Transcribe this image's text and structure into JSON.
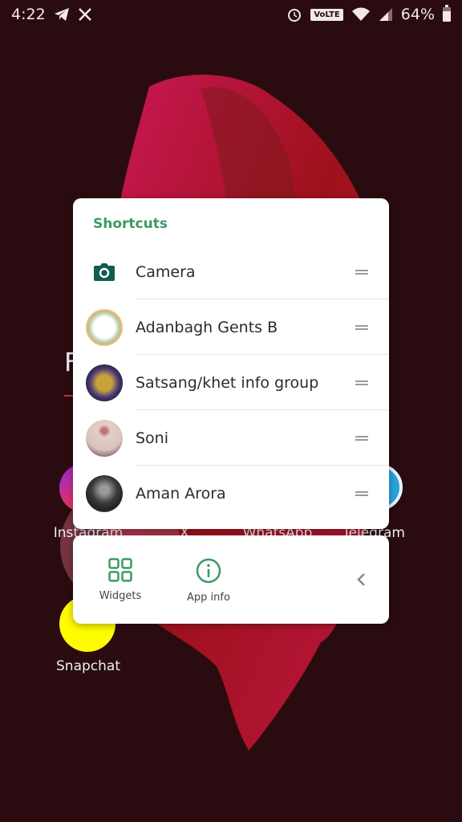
{
  "status_bar": {
    "time": "4:22",
    "notification_icons": [
      "telegram-icon",
      "x-icon"
    ],
    "system_icons": [
      "alarm-icon",
      "volte-icon",
      "wifi-icon",
      "signal-icon"
    ],
    "volte_label": "VoLTE",
    "battery_percent": "64%",
    "battery_level": 0.64
  },
  "home": {
    "folder_letter": "F",
    "apps": [
      {
        "name": "Instagram",
        "icon": "instagram-icon"
      },
      {
        "name": "X",
        "icon": "x-icon"
      },
      {
        "name": "WhatsApp",
        "icon": "whatsapp-icon"
      },
      {
        "name": "Telegram",
        "icon": "telegram-icon"
      },
      {
        "name": "Snapchat",
        "icon": "snapchat-icon"
      }
    ]
  },
  "shortcuts_menu": {
    "title": "Shortcuts",
    "items": [
      {
        "label": "Camera",
        "icon": "camera-icon"
      },
      {
        "label": "Adanbagh Gents B",
        "icon": "group-avatar"
      },
      {
        "label": "Satsang/khet info group",
        "icon": "group-avatar"
      },
      {
        "label": "Soni",
        "icon": "contact-avatar"
      },
      {
        "label": "Aman Arora",
        "icon": "contact-avatar"
      }
    ]
  },
  "actions_menu": {
    "widgets_label": "Widgets",
    "app_info_label": "App info"
  },
  "colors": {
    "accent_green": "#3a9a64",
    "camera_icon": "#0f5c50",
    "background": "#2a0c10"
  }
}
